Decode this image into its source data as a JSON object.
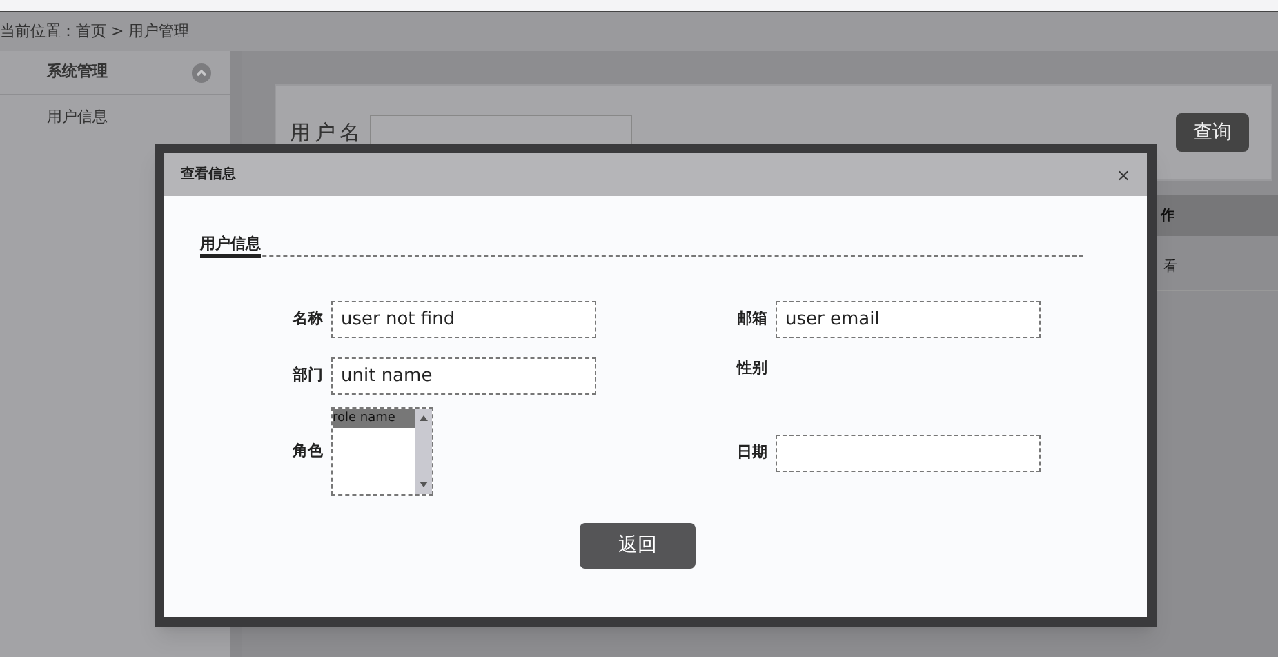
{
  "breadcrumb": "当前位置：首页 > 用户管理",
  "sidebar": {
    "header": {
      "label": "系统管理",
      "expanded": true
    },
    "items": [
      {
        "label": "用户信息"
      }
    ]
  },
  "search": {
    "label": "用户名",
    "button": "查询"
  },
  "table": {
    "columns": [
      "作"
    ],
    "rows": [
      [
        "看"
      ]
    ]
  },
  "dialog": {
    "title": "查看信息",
    "close": "×",
    "section": "用户信息",
    "fields": [
      {
        "kind": "text",
        "label": "名称",
        "value": "user not find"
      },
      {
        "kind": "text",
        "label": "邮箱",
        "value": "user email"
      },
      {
        "kind": "text",
        "label": "部门",
        "value": "unit name"
      },
      {
        "kind": "blank",
        "label": "性别"
      },
      {
        "kind": "list",
        "label": "角色",
        "options": [
          {
            "label": "role name",
            "selected": true
          }
        ]
      },
      {
        "kind": "text",
        "label": "日期"
      }
    ],
    "button": "返回"
  }
}
